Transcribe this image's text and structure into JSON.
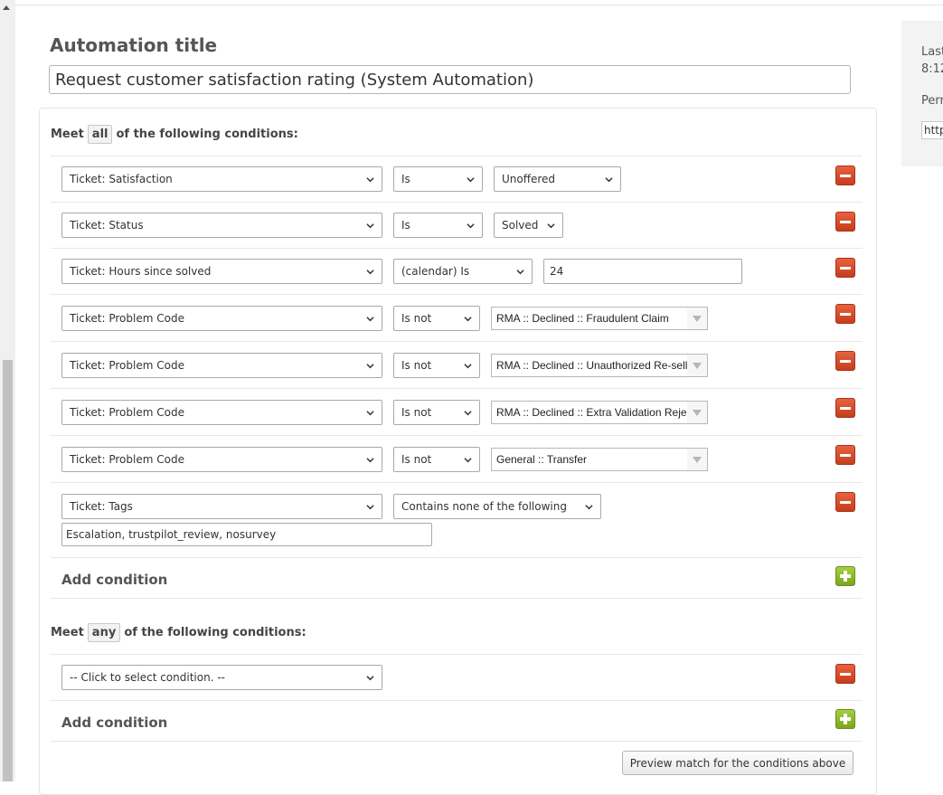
{
  "title_section": {
    "label": "Automation title",
    "value": "Request customer satisfaction rating (System Automation)"
  },
  "all_group": {
    "meet_prefix": "Meet",
    "keyword": "all",
    "meet_suffix": "of the following conditions:",
    "conditions": [
      {
        "field": "Ticket: Satisfaction",
        "operator": "Is",
        "value": "Unoffered"
      },
      {
        "field": "Ticket: Status",
        "operator": "Is",
        "value": "Solved"
      },
      {
        "field": "Ticket: Hours since solved",
        "operator": "(calendar) Is",
        "value": "24"
      },
      {
        "field": "Ticket: Problem Code",
        "operator": "Is not",
        "value": "RMA :: Declined :: Fraudulent Claim"
      },
      {
        "field": "Ticket: Problem Code",
        "operator": "Is not",
        "value": "RMA :: Declined :: Unauthorized Re-sell"
      },
      {
        "field": "Ticket: Problem Code",
        "operator": "Is not",
        "value": "RMA :: Declined :: Extra Validation Reje"
      },
      {
        "field": "Ticket: Problem Code",
        "operator": "Is not",
        "value": "General :: Transfer"
      },
      {
        "field": "Ticket: Tags",
        "operator": "Contains none of the following",
        "value": "Escalation, trustpilot_review, nosurvey"
      }
    ],
    "add_label": "Add condition"
  },
  "any_group": {
    "meet_prefix": "Meet",
    "keyword": "any",
    "meet_suffix": "of the following conditions:",
    "conditions": [
      {
        "field": "-- Click to select condition. --"
      }
    ],
    "add_label": "Add condition"
  },
  "preview_button": "Preview match for the conditions above",
  "side_panel": {
    "last_line1": "Last",
    "last_line2": "8:12",
    "perm_label": "Perr",
    "perm_value": "http"
  }
}
